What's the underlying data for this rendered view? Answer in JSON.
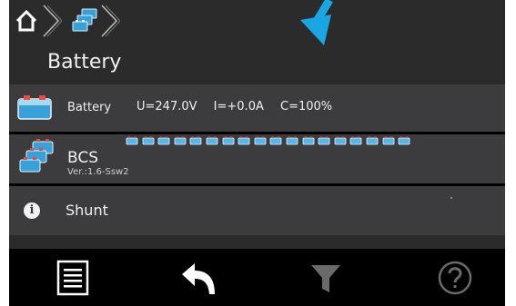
{
  "header": {
    "title": "Battery"
  },
  "crumbs": {
    "home_icon": "home-icon",
    "battery_icon": "battery-group-icon"
  },
  "rows": [
    {
      "label": "Battery",
      "icon": "battery-icon",
      "readings": {
        "voltage": "U=247.0V",
        "current": "I=+0.0A",
        "capacity": "C=100%"
      }
    },
    {
      "label": "BCS",
      "sub": "Ver.:1.6-Ssw2",
      "icon": "battery-stack-icon",
      "cell_count": 18
    },
    {
      "label": "Shunt",
      "icon": "info-icon",
      "icon_glyph": "i"
    }
  ],
  "toolbar": {
    "items": [
      "list-icon",
      "back-arrow-icon",
      "filter-icon",
      "help-icon"
    ]
  },
  "colors": {
    "background": "#000000",
    "header": "#2b2b2c",
    "row": "#3c3c3e",
    "text": "#f0f0f0",
    "hint_arrow": "#1aa6e3",
    "disabled": "#6a6a6a"
  }
}
